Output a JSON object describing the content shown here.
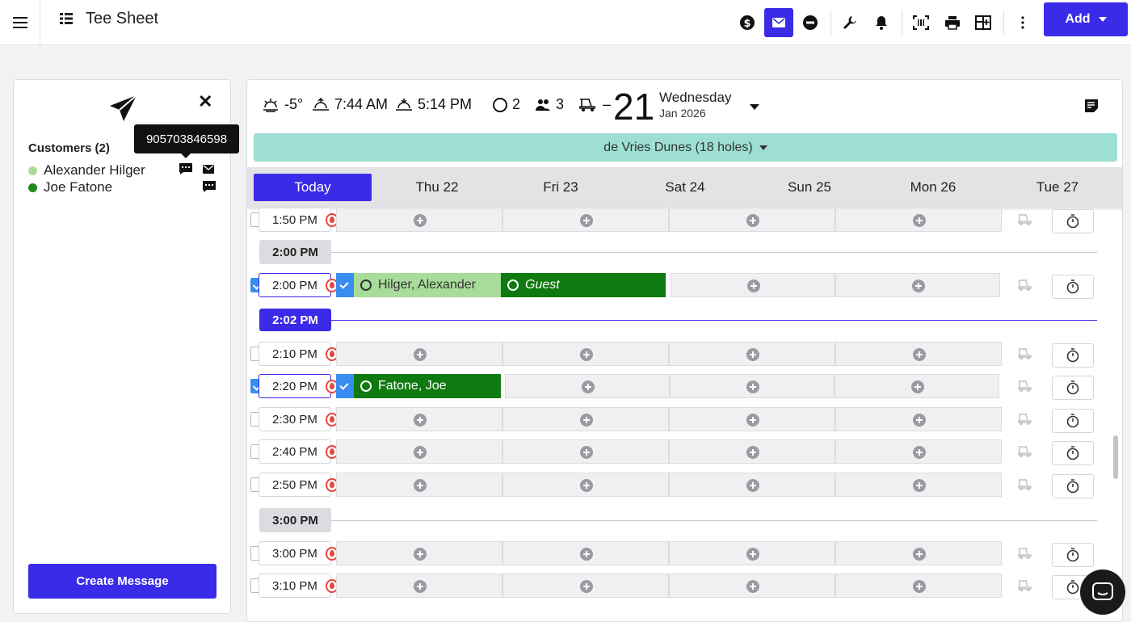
{
  "topbar": {
    "title": "Tee Sheet",
    "add_label": "Add",
    "icons": [
      "dollar-icon",
      "mail-icon",
      "block-icon",
      "wrench-icon",
      "bell-icon",
      "barcode-icon",
      "print-icon",
      "layout-icon",
      "more-icon"
    ]
  },
  "left": {
    "customers_title": "Customers (2)",
    "tooltip": "905703846598",
    "customers": [
      {
        "name": "Alexander Hilger",
        "color": "#a8dc9a"
      },
      {
        "name": "Joe Fatone",
        "color": "#1f8a1f"
      }
    ],
    "create_label": "Create Message"
  },
  "header": {
    "temp": "-5°",
    "sunrise": "7:44 AM",
    "sunset": "5:14 PM",
    "rounds": "2",
    "players": "3",
    "carts": "–",
    "day_number": "21",
    "day_name": "Wednesday",
    "month_year": "Jan 2026",
    "course": "de Vries Dunes (18 holes)"
  },
  "tabs": [
    "Today",
    "Thu 22",
    "Fri 23",
    "Sat 24",
    "Sun 25",
    "Mon 26",
    "Tue 27"
  ],
  "sheet": {
    "rows": [
      {
        "time": "1:50 PM"
      },
      {
        "hour": "2:00 PM"
      },
      {
        "time": "2:00 PM",
        "checked": true,
        "bookings": [
          {
            "name": "Hilger, Alexander"
          },
          {
            "name": "Guest"
          }
        ]
      },
      {
        "now": "2:02 PM"
      },
      {
        "time": "2:10 PM"
      },
      {
        "time": "2:20 PM",
        "checked": true,
        "bookings": [
          {
            "name": "Fatone, Joe"
          }
        ]
      },
      {
        "time": "2:30 PM"
      },
      {
        "time": "2:40 PM"
      },
      {
        "time": "2:50 PM"
      },
      {
        "hour": "3:00 PM"
      },
      {
        "time": "3:00 PM"
      },
      {
        "time": "3:10 PM"
      }
    ]
  },
  "colors": {
    "accent": "#3a2be8",
    "booking_light": "#a8dc9a",
    "booking_dark": "#0f7a0f",
    "course_bar": "#9ddfd3"
  }
}
